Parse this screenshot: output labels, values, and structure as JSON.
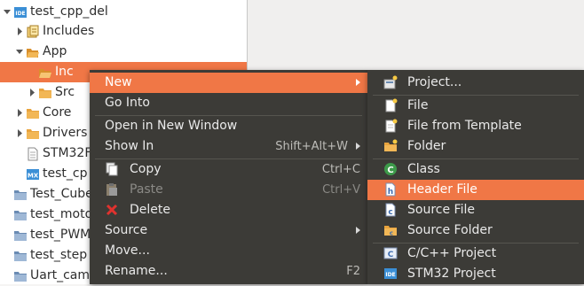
{
  "tree": {
    "items": [
      {
        "label": "test_cpp_del",
        "icon": "ide-project-icon",
        "twisty": "expanded"
      },
      {
        "label": "Includes",
        "icon": "includes-icon",
        "twisty": "collapsed"
      },
      {
        "label": "App",
        "icon": "folder-open-icon",
        "twisty": "expanded"
      },
      {
        "label": "Inc",
        "icon": "folder-open-icon",
        "twisty": "none",
        "selected": true
      },
      {
        "label": "Src",
        "icon": "folder-icon",
        "twisty": "collapsed"
      },
      {
        "label": "Core",
        "icon": "folder-icon",
        "twisty": "collapsed"
      },
      {
        "label": "Drivers",
        "icon": "folder-icon",
        "twisty": "collapsed"
      },
      {
        "label": "STM32F",
        "icon": "file-icon",
        "twisty": "none"
      },
      {
        "label": "test_cp",
        "icon": "mx-file-icon",
        "twisty": "none"
      },
      {
        "label": "Test_Cube",
        "icon": "project-closed-icon",
        "twisty": "none"
      },
      {
        "label": "test_moto",
        "icon": "project-closed-icon",
        "twisty": "none"
      },
      {
        "label": "test_PWM",
        "icon": "project-closed-icon",
        "twisty": "none"
      },
      {
        "label": "test_step",
        "icon": "project-closed-icon",
        "twisty": "none"
      },
      {
        "label": "Uart_cam",
        "icon": "project-closed-icon",
        "twisty": "none"
      }
    ]
  },
  "context_menu": {
    "items": [
      {
        "label": "New",
        "submenu": true,
        "highlighted": true
      },
      {
        "label": "Go Into"
      },
      {
        "separator": true
      },
      {
        "label": "Open in New Window"
      },
      {
        "label": "Show In",
        "accelerator": "Shift+Alt+W",
        "submenu": true
      },
      {
        "separator": true
      },
      {
        "label": "Copy",
        "accelerator": "Ctrl+C",
        "icon": "copy-icon"
      },
      {
        "label": "Paste",
        "accelerator": "Ctrl+V",
        "icon": "paste-icon",
        "disabled": true
      },
      {
        "label": "Delete",
        "icon": "delete-icon"
      },
      {
        "label": "Source",
        "submenu": true
      },
      {
        "label": "Move..."
      },
      {
        "label": "Rename...",
        "accelerator": "F2"
      }
    ]
  },
  "new_submenu": {
    "items": [
      {
        "label": "Project...",
        "icon": "new-project-icon"
      },
      {
        "separator": true
      },
      {
        "label": "File",
        "icon": "new-file-icon"
      },
      {
        "label": "File from Template",
        "icon": "file-template-icon"
      },
      {
        "label": "Folder",
        "icon": "new-folder-icon"
      },
      {
        "separator": true
      },
      {
        "label": "Class",
        "icon": "class-icon"
      },
      {
        "label": "Header File",
        "icon": "header-file-icon",
        "highlighted": true
      },
      {
        "label": "Source File",
        "icon": "source-file-icon"
      },
      {
        "label": "Source Folder",
        "icon": "source-folder-icon"
      },
      {
        "separator": true
      },
      {
        "label": "C/C++ Project",
        "icon": "c-cpp-project-icon"
      },
      {
        "label": "STM32 Project",
        "icon": "stm32-project-icon"
      }
    ]
  },
  "colors": {
    "selection": "#f07746",
    "menu_background": "#3c3b37",
    "menu_text": "#e9e9e9",
    "folder": "#e8a33d",
    "ide_blue": "#3b8fd6"
  }
}
